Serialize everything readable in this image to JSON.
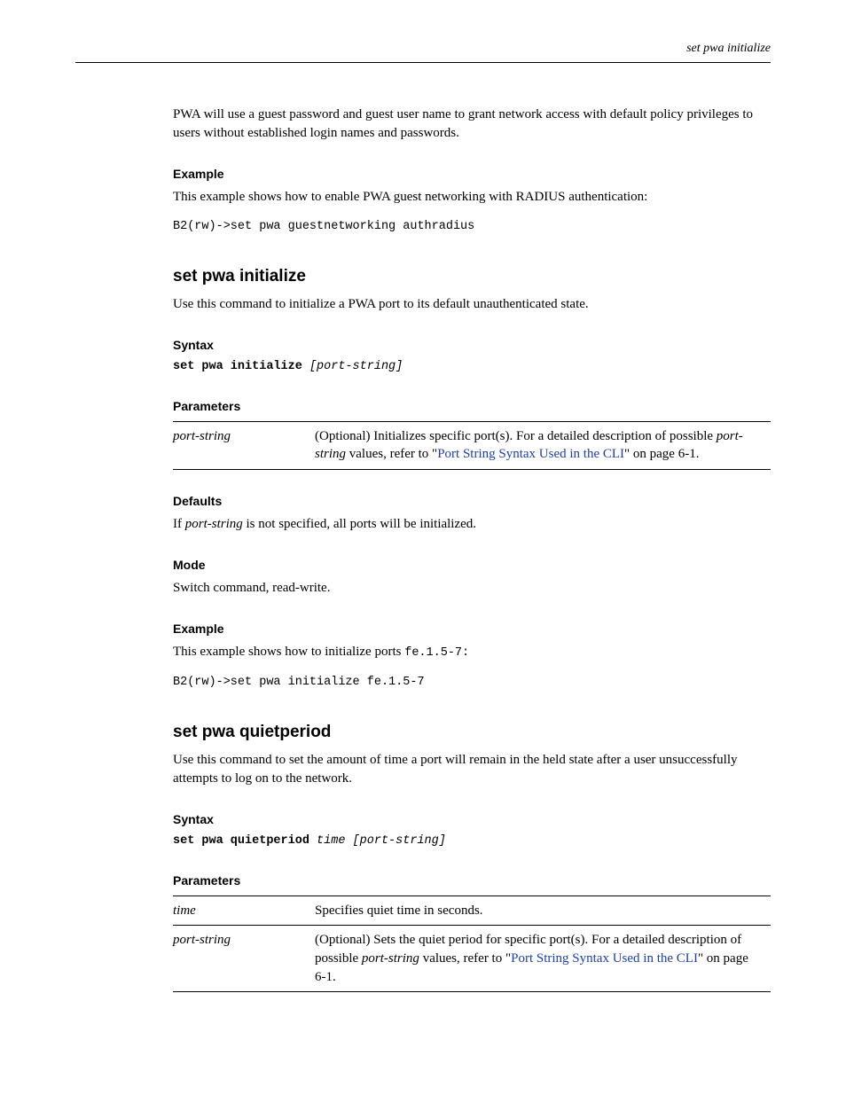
{
  "header": {
    "right": "set pwa initialize"
  },
  "intro": {
    "para": "PWA will use a guest password and guest user name to grant network access with default policy privileges to users without established login names and passwords."
  },
  "example1": {
    "heading": "Example",
    "para": "This example shows how to enable PWA guest networking with RADIUS authentication:",
    "code": "B2(rw)->set pwa guestnetworking authradius"
  },
  "sec_init": {
    "heading": "set pwa initialize",
    "para": "Use this command to initialize a PWA port to its default unauthenticated state.",
    "syntax_heading": "Syntax",
    "syntax_pre": "set pwa initialize ",
    "syntax_arg": "[port-string]",
    "params_heading": "Parameters",
    "row1_name": "port-string",
    "row1_a": "(Optional) Initializes specific port(s). For a detailed description of possible ",
    "row1_arg": "port-string",
    "row1_b": " values, refer to \"",
    "row1_link": "Port String Syntax Used in the CLI",
    "row1_c": "\" on page 6-1.",
    "defaults_heading": "Defaults",
    "defaults_a": "If ",
    "defaults_arg": "port-string",
    "defaults_b": " is not specified, all ports will be initialized.",
    "mode_heading": "Mode",
    "mode_para": "Switch command, read-write.",
    "example_heading": "Example",
    "example_a": "This example shows how to initialize ports ",
    "example_code": "fe.1.5-7:",
    "example_block": "B2(rw)->set pwa initialize fe.1.5-7"
  },
  "sec_quiet": {
    "heading": "set pwa quietperiod",
    "para": "Use this command to set the amount of time a port will remain in the held state after a user unsuccessfully attempts to log on to the network.",
    "syntax_heading": "Syntax",
    "syntax_pre": "set pwa quietperiod ",
    "syntax_arg1": "time ",
    "syntax_arg2": "[port-string]",
    "params_heading": "Parameters",
    "row1_name": "time",
    "row1_desc": "Specifies quiet time in seconds.",
    "row2_name": "port-string",
    "row2_a": "(Optional) Sets the quiet period for specific port(s). For a detailed description of possible ",
    "row2_arg": "port-string",
    "row2_b": " values, refer to \"",
    "row2_link": "Port String Syntax Used in the CLI",
    "row2_c": "\" on page 6-1."
  }
}
